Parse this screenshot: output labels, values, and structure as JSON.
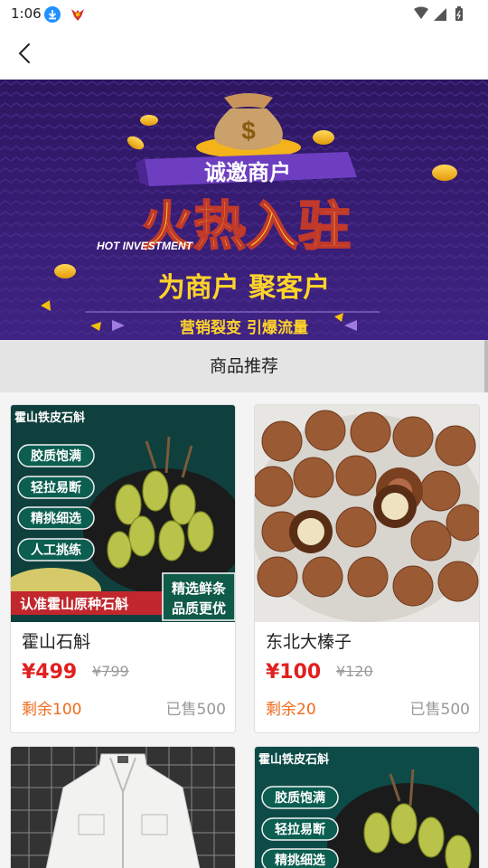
{
  "status": {
    "time": "1:06"
  },
  "header": {
    "back_icon": "back-arrow-icon"
  },
  "banner": {
    "top_label": "诚邀商户",
    "main_title": "火热入驻",
    "sub_en": "HOT INVESTMENT",
    "slogan": "为商户   聚客户",
    "tagline": "营销裂变  引爆流量"
  },
  "section": {
    "title": "商品推荐"
  },
  "products": [
    {
      "name": "霍山石斛",
      "price": "¥499",
      "old_price": "¥799",
      "remain": "剩余100",
      "sold": "已售500",
      "img": {
        "brand": "霍山铁皮石斛",
        "tags": [
          "胶质饱满",
          "轻拉易断",
          "精挑细选",
          "人工挑练"
        ],
        "bottom_left": "认准霍山原种石斛",
        "bottom_right_1": "精选鲜条",
        "bottom_right_2": "品质更优"
      }
    },
    {
      "name": "东北大榛子",
      "price": "¥100",
      "old_price": "¥120",
      "remain": "剩余20",
      "sold": "已售500"
    },
    {
      "name": "",
      "img_desc": "white jacket"
    },
    {
      "name": "",
      "img": {
        "brand": "霍山铁皮石斛",
        "tags": [
          "胶质饱满",
          "轻拉易断",
          "精挑细选"
        ]
      }
    }
  ],
  "colors": {
    "price": "#e0201f",
    "remain": "#f06a1a",
    "banner_bg": "#3a1e6e"
  }
}
